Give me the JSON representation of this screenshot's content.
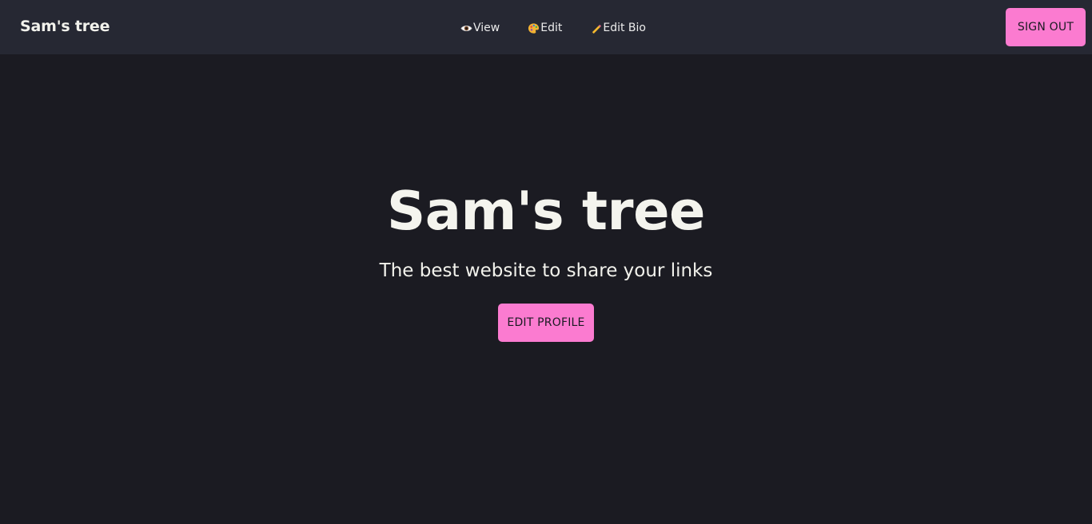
{
  "navbar": {
    "brand": "Sam's tree",
    "links": [
      {
        "label": "View",
        "icon": "eye-icon"
      },
      {
        "label": "Edit",
        "icon": "palette-icon"
      },
      {
        "label": "Edit Bio",
        "icon": "pencil-icon"
      }
    ],
    "sign_out_label": "SIGN OUT"
  },
  "hero": {
    "title": "Sam's tree",
    "subtitle": "The best website to share your links",
    "cta_label": "EDIT PROFILE"
  },
  "colors": {
    "background": "#1b1b22",
    "navbar": "#262833",
    "accent": "#fb7bd0",
    "text": "#f2f2ec"
  }
}
